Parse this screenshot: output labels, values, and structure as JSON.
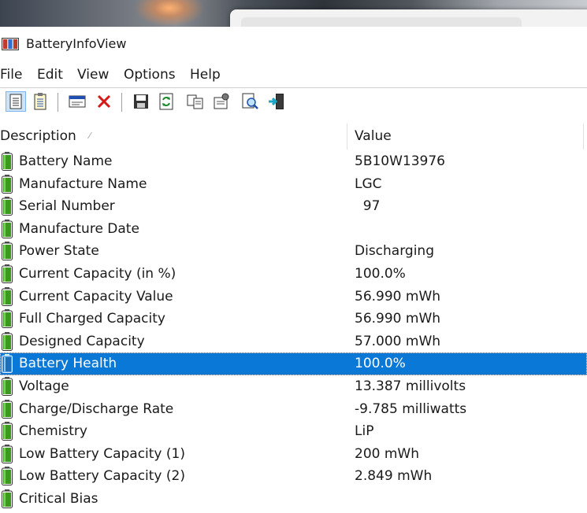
{
  "window": {
    "title": "BatteryInfoView"
  },
  "menu": [
    "File",
    "Edit",
    "View",
    "Options",
    "Help"
  ],
  "toolbar": [
    {
      "name": "html-report-icon",
      "pressed": true
    },
    {
      "name": "text-report-icon"
    },
    {
      "name": "properties-window-icon"
    },
    {
      "name": "delete-icon"
    },
    {
      "name": "save-icon"
    },
    {
      "name": "refresh-icon"
    },
    {
      "name": "copy-icon"
    },
    {
      "name": "properties-icon"
    },
    {
      "name": "find-icon"
    },
    {
      "name": "exit-icon"
    }
  ],
  "columns": {
    "description": "Description",
    "value": "Value"
  },
  "rows": [
    {
      "description": "Battery Name",
      "value": "5B10W13976"
    },
    {
      "description": "Manufacture Name",
      "value": "LGC"
    },
    {
      "description": "Serial Number",
      "value": "  97"
    },
    {
      "description": "Manufacture Date",
      "value": ""
    },
    {
      "description": "Power State",
      "value": "Discharging"
    },
    {
      "description": "Current Capacity (in %)",
      "value": "100.0%"
    },
    {
      "description": "Current Capacity Value",
      "value": "56.990 mWh"
    },
    {
      "description": "Full Charged Capacity",
      "value": "56.990 mWh"
    },
    {
      "description": "Designed Capacity",
      "value": "57.000 mWh"
    },
    {
      "description": "Battery Health",
      "value": "100.0%",
      "selected": true
    },
    {
      "description": "Voltage",
      "value": "13.387 millivolts"
    },
    {
      "description": "Charge/Discharge Rate",
      "value": "-9.785 milliwatts"
    },
    {
      "description": "Chemistry",
      "value": "LiP"
    },
    {
      "description": "Low Battery Capacity (1)",
      "value": "200 mWh"
    },
    {
      "description": "Low Battery Capacity (2)",
      "value": "2.849 mWh"
    },
    {
      "description": "Critical Bias",
      "value": ""
    }
  ],
  "colors": {
    "selection": "#0a78d7",
    "battery_green": "#3a9a1e"
  }
}
